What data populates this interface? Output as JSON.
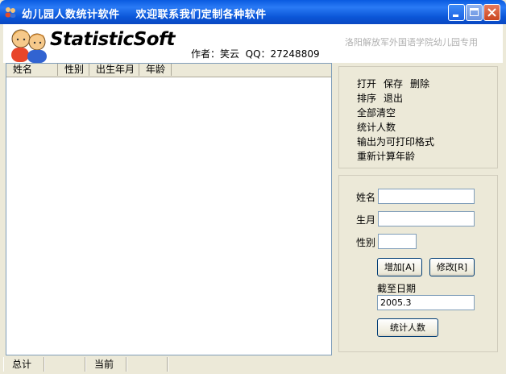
{
  "window": {
    "title": "幼儿园人数统计软件    欢迎联系我们定制各种软件"
  },
  "header": {
    "brand": "StatisticSoft",
    "author": "作者：笑云  QQ：27248809",
    "subtitle": "洛阳解放军外国语学院幼儿园专用"
  },
  "list": {
    "columns": [
      "姓名",
      "性别",
      "出生年月",
      "年龄"
    ]
  },
  "menu": {
    "row1": [
      "打开",
      "保存",
      "删除"
    ],
    "row2": [
      "排序",
      "退出"
    ],
    "clear_all": "全部清空",
    "count": "统计人数",
    "export": "输出为可打印格式",
    "recalc": "重新计算年龄"
  },
  "form": {
    "name_label": "姓名",
    "name_value": "",
    "birth_label": "生月",
    "birth_value": "",
    "gender_label": "性别",
    "gender_value": "",
    "add_button": "增加[A]",
    "edit_button": "修改[R]",
    "cutoff_label": "截至日期",
    "cutoff_value": "2005.3",
    "count_button": "统计人数"
  },
  "status": {
    "total_label": "总计",
    "total_value": "",
    "current_label": "当前",
    "current_value": ""
  },
  "colors": {
    "titlebar": "#0a5be0",
    "face": "#ece9d8",
    "field_border": "#7f9db9"
  }
}
